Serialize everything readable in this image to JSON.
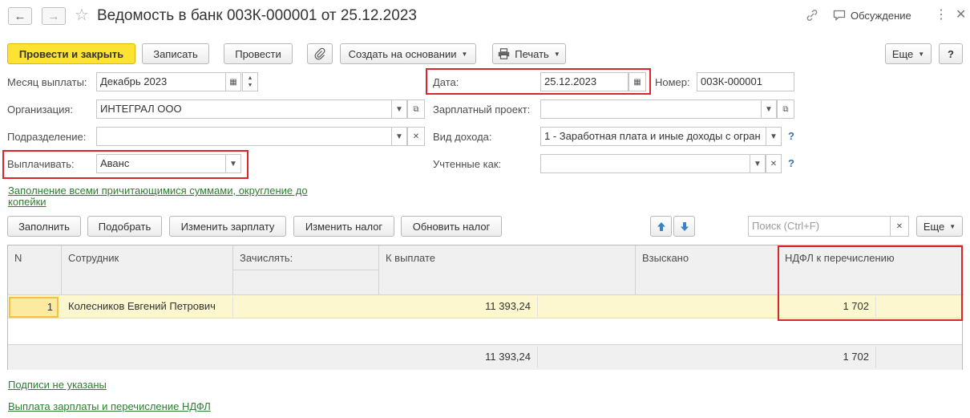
{
  "header": {
    "title": "Ведомость в банк 003К-000001 от 25.12.2023",
    "discussion_label": "Обсуждение"
  },
  "toolbar": {
    "post_close": "Провести и закрыть",
    "save": "Записать",
    "post": "Провести",
    "create_based": "Создать на основании",
    "print": "Печать",
    "more": "Еще",
    "help": "?"
  },
  "form": {
    "month_label": "Месяц выплаты:",
    "month_value": "Декабрь 2023",
    "date_label": "Дата:",
    "date_value": "25.12.2023",
    "number_label": "Номер:",
    "number_value": "003К-000001",
    "org_label": "Организация:",
    "org_value": "ИНТЕГРАЛ ООО",
    "salary_project_label": "Зарплатный проект:",
    "salary_project_value": "",
    "division_label": "Подразделение:",
    "division_value": "",
    "income_type_label": "Вид дохода:",
    "income_type_value": "1 - Заработная плата и иные доходы с огран",
    "pay_label": "Выплачивать:",
    "pay_value": "Аванс",
    "counted_as_label": "Учтенные как:",
    "counted_as_value": "",
    "fill_link_line1": "Заполнение всеми причитающимися суммами, округление до",
    "fill_link_line2": "копейки"
  },
  "table_toolbar": {
    "fill": "Заполнить",
    "pick": "Подобрать",
    "change_salary": "Изменить зарплату",
    "change_tax": "Изменить налог",
    "update_tax": "Обновить налог",
    "search_placeholder": "Поиск (Ctrl+F)",
    "more": "Еще"
  },
  "table": {
    "columns": [
      "N",
      "Сотрудник",
      "Зачислять:",
      "К выплате",
      "Взыскано",
      "НДФЛ к перечислению"
    ],
    "rows": [
      {
        "n": "1",
        "employee": "Колесников Евгений Петрович",
        "credit": "",
        "to_pay": "11 393,24",
        "collected": "",
        "ndfl": "1 702"
      }
    ],
    "totals": {
      "to_pay": "11 393,24",
      "ndfl": "1 702"
    }
  },
  "footer": {
    "signatures_link": "Подписи не указаны",
    "payment_link": "Выплата зарплаты и перечисление НДФЛ"
  },
  "colors": {
    "primary_button": "#fbe233",
    "highlight": "#d9252b",
    "link": "#2c7e2f",
    "selected_row": "#fdf7cf"
  }
}
